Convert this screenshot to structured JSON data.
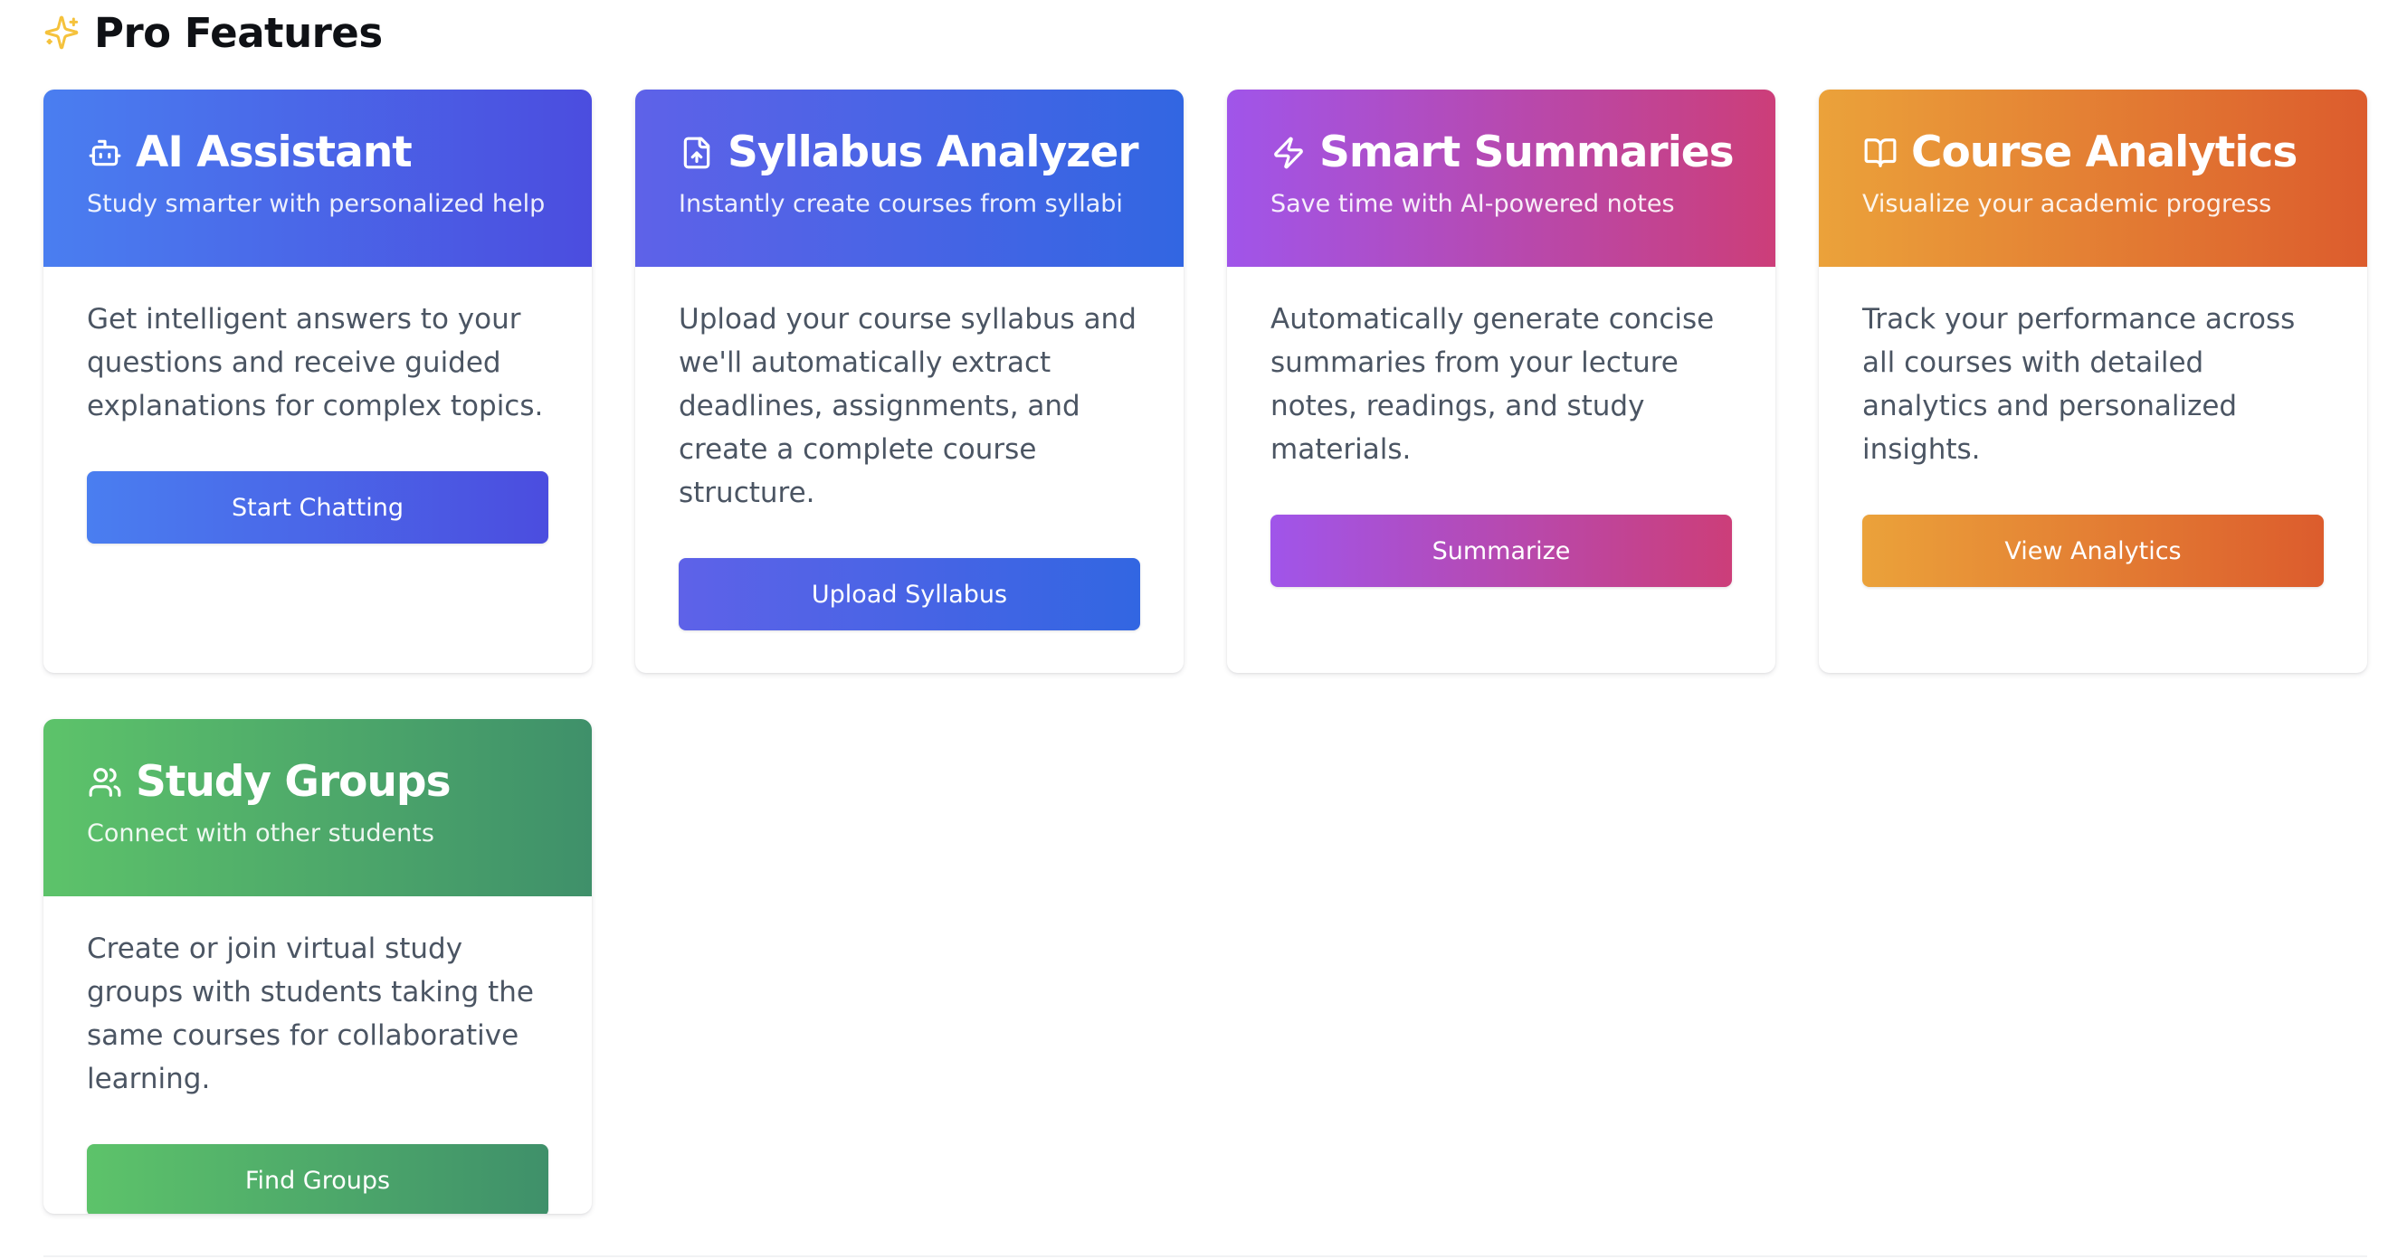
{
  "section": {
    "title": "Pro Features",
    "icon": "sparkle-icon"
  },
  "colors": {
    "sparkle": "#f5c23c",
    "ai_assistant": [
      "#4a7ef0",
      "#4b4ddf"
    ],
    "syllabus_analyzer": [
      "#5e62e8",
      "#3266e2"
    ],
    "smart_summaries": [
      "#a055ea",
      "#cc3e79"
    ],
    "course_analytics": [
      "#eba23a",
      "#dc5c2d"
    ],
    "study_groups": [
      "#5dc36a",
      "#3f906a"
    ]
  },
  "cards": [
    {
      "icon": "bot-icon",
      "title": "AI Assistant",
      "subtitle": "Study smarter with personalized help",
      "description": "Get intelligent answers to your questions and receive guided explanations for complex topics.",
      "button": "Start Chatting"
    },
    {
      "icon": "file-upload-icon",
      "title": "Syllabus Analyzer",
      "subtitle": "Instantly create courses from syllabi",
      "description": "Upload your course syllabus and we'll automatically extract deadlines, assignments, and create a complete course structure.",
      "button": "Upload Syllabus"
    },
    {
      "icon": "lightning-icon",
      "title": "Smart Summaries",
      "subtitle": "Save time with AI-powered notes",
      "description": "Automatically generate concise summaries from your lecture notes, readings, and study materials.",
      "button": "Summarize"
    },
    {
      "icon": "open-book-icon",
      "title": "Course Analytics",
      "subtitle": "Visualize your academic progress",
      "description": "Track your performance across all courses with detailed analytics and personalized insights.",
      "button": "View Analytics"
    },
    {
      "icon": "users-icon",
      "title": "Study Groups",
      "subtitle": "Connect with other students",
      "description": "Create or join virtual study groups with students taking the same courses for collaborative learning.",
      "button": "Find Groups"
    }
  ]
}
